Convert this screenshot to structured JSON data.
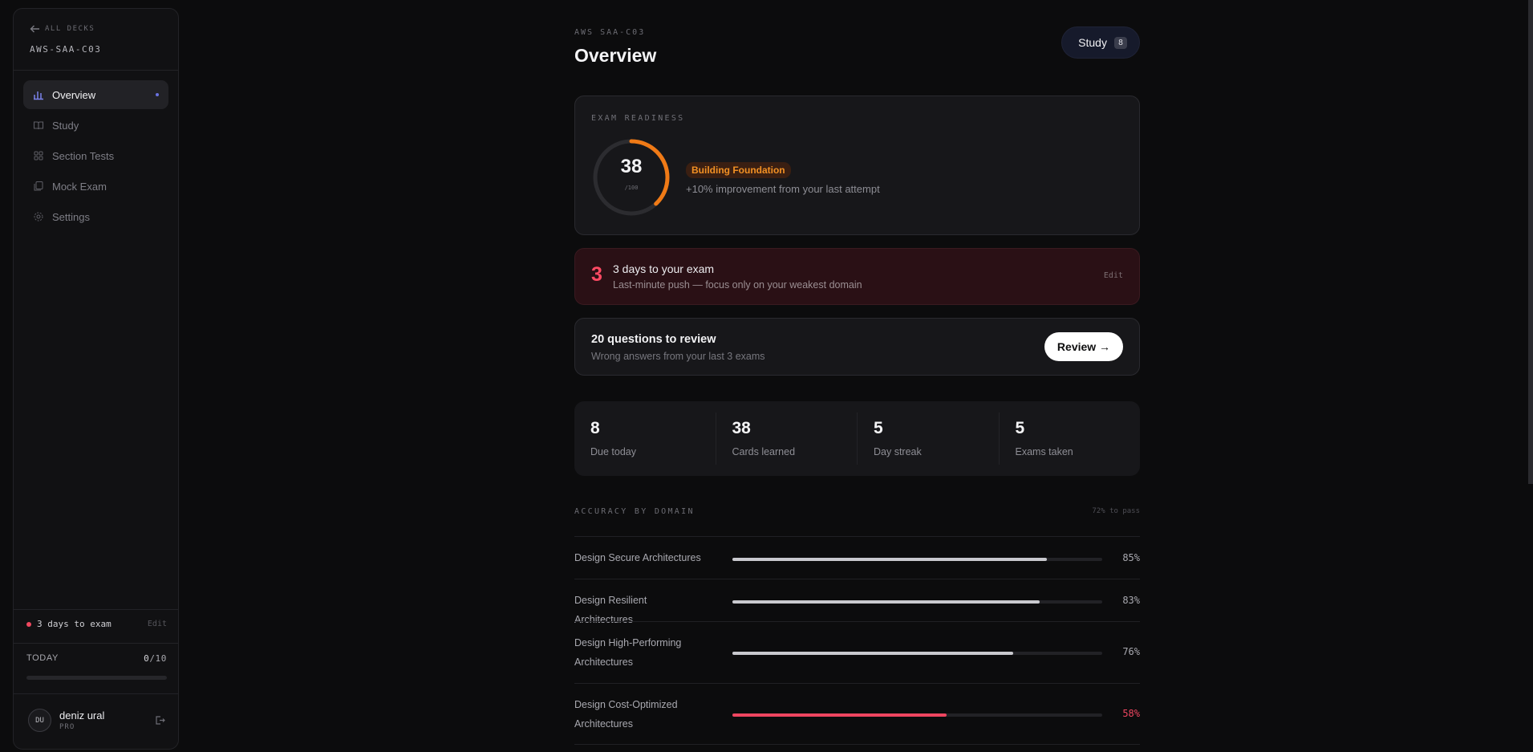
{
  "sidebar": {
    "back_label": "ALL DECKS",
    "deck_code": "AWS-SAA-C03",
    "nav": [
      {
        "label": "Overview",
        "icon": "bar-chart-icon",
        "active": true
      },
      {
        "label": "Study",
        "icon": "book-icon",
        "active": false
      },
      {
        "label": "Section Tests",
        "icon": "grid-icon",
        "active": false
      },
      {
        "label": "Mock Exam",
        "icon": "stack-icon",
        "active": false
      },
      {
        "label": "Settings",
        "icon": "gear-icon",
        "active": false
      }
    ],
    "exam_status": "3 days to exam",
    "exam_edit": "Edit",
    "today_label": "TODAY",
    "today_done": "0",
    "today_total": "/10",
    "today_progress": 0,
    "user": {
      "initials": "DU",
      "name": "deniz ural",
      "plan": "PRO"
    }
  },
  "header": {
    "crumb": "AWS SAA-C03",
    "title": "Overview",
    "study_label": "Study",
    "study_count": "8"
  },
  "readiness": {
    "label": "EXAM READINESS",
    "score": "38",
    "score_max": "/100",
    "score_fraction": 0.38,
    "badge": "Building Foundation",
    "improvement": "+10% improvement from your last attempt"
  },
  "countdown": {
    "days": "3",
    "title": "3 days to your exam",
    "subtitle": "Last-minute push — focus only on your weakest domain",
    "edit": "Edit"
  },
  "review": {
    "title": "20 questions to review",
    "subtitle": "Wrong answers from your last 3 exams",
    "button": "Review →"
  },
  "stats": [
    {
      "value": "8",
      "label": "Due today"
    },
    {
      "value": "38",
      "label": "Cards learned"
    },
    {
      "value": "5",
      "label": "Day streak"
    },
    {
      "value": "5",
      "label": "Exams taken"
    }
  ],
  "accuracy": {
    "title": "ACCURACY BY DOMAIN",
    "pass_note": "72% to pass",
    "domains": [
      {
        "name": "Design Secure Architectures",
        "pct": "85%",
        "value": 85
      },
      {
        "name": "Design Resilient Architectures",
        "pct": "83%",
        "value": 83
      },
      {
        "name": "Design High-Performing Architectures",
        "pct": "76%",
        "value": 76
      },
      {
        "name": "Design Cost-Optimized Architectures",
        "pct": "58%",
        "value": 58
      }
    ]
  },
  "colors": {
    "accent": "#6a72e0",
    "orange": "#f07a16",
    "danger": "#ef4660"
  }
}
